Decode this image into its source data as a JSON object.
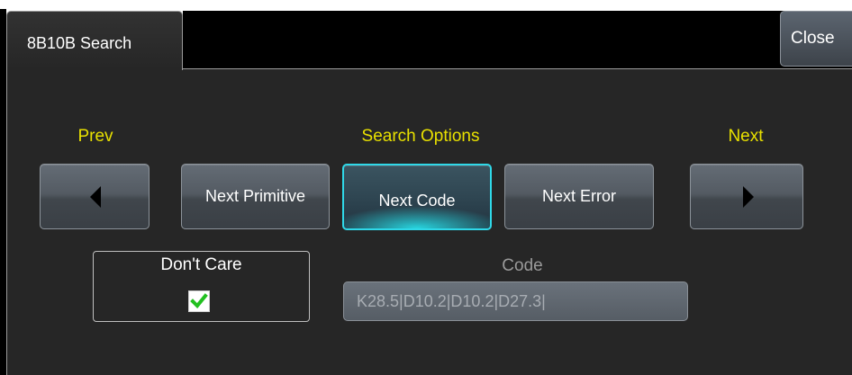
{
  "tab": {
    "label": "8B10B Search"
  },
  "close_button": {
    "label": "Close"
  },
  "labels": {
    "prev": "Prev",
    "search_options": "Search Options",
    "next": "Next",
    "code": "Code"
  },
  "buttons": {
    "next_primitive": "Next Primitive",
    "next_code": "Next Code",
    "next_error": "Next Error"
  },
  "selected_option": "Next Code",
  "dont_care": {
    "label": "Don't Care",
    "checked": true
  },
  "code_field": {
    "value": "K28.5|D10.2|D10.2|D27.3|"
  },
  "colors": {
    "label_accent": "#e8e000",
    "active_glow": "#2fd8e8",
    "check": "#22c020"
  }
}
